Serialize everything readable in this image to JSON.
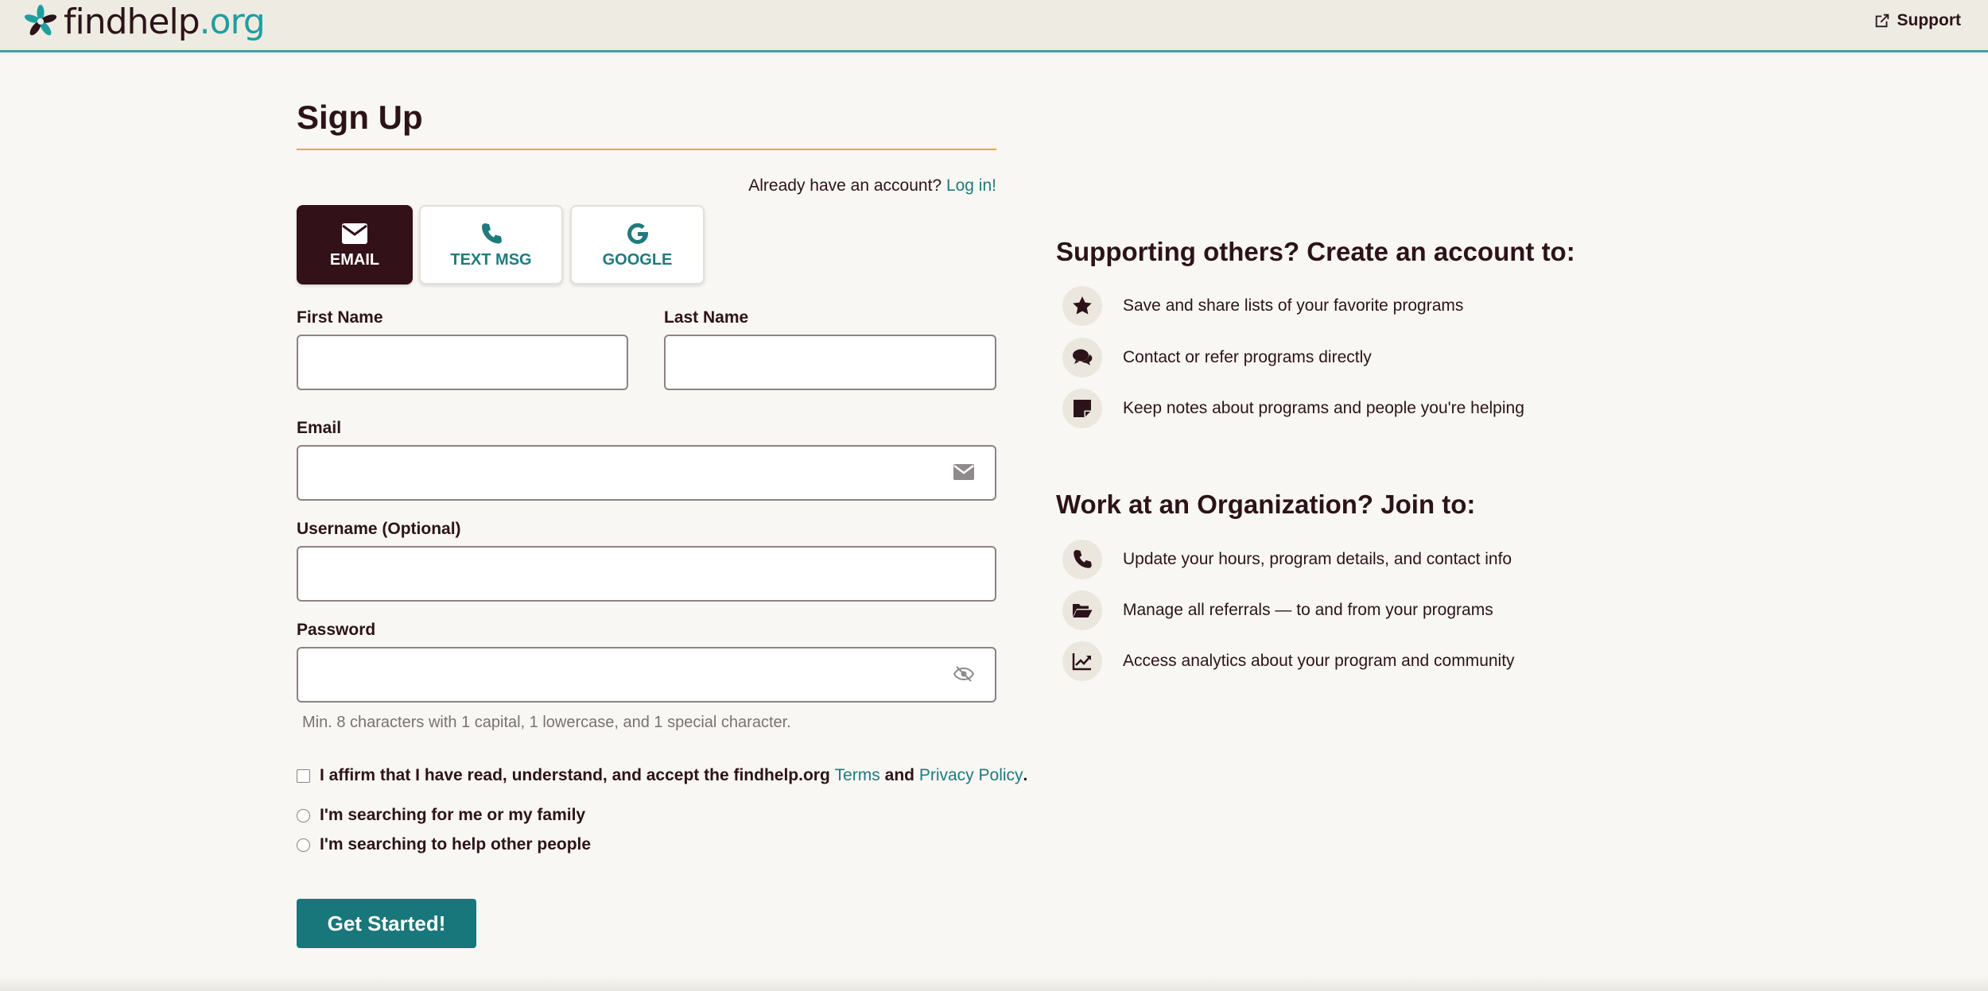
{
  "header": {
    "logo_find": "findhelp",
    "logo_suffix": ".org",
    "support_label": "Support"
  },
  "form": {
    "title": "Sign Up",
    "login_prompt": "Already have an account?",
    "login_link": "Log in!",
    "methods": [
      {
        "label": "EMAIL",
        "icon": "envelope-icon",
        "active": true
      },
      {
        "label": "TEXT MSG",
        "icon": "phone-icon",
        "active": false
      },
      {
        "label": "GOOGLE",
        "icon": "google-icon",
        "active": false
      }
    ],
    "first_name_label": "First Name",
    "first_name_value": "",
    "last_name_label": "Last Name",
    "last_name_value": "",
    "email_label": "Email",
    "email_value": "",
    "username_label": "Username (Optional)",
    "username_value": "",
    "password_label": "Password",
    "password_value": "",
    "password_hint": "Min. 8 characters with 1 capital, 1 lowercase, and 1 special character.",
    "affirm_text": "I affirm that I have read, understand, and accept the findhelp.org",
    "terms_link": "Terms",
    "and_text": "and",
    "privacy_link": "Privacy Policy",
    "period": ".",
    "radio_self": "I'm searching for me or my family",
    "radio_others": "I'm searching to help other people",
    "submit_label": "Get Started!"
  },
  "side": {
    "supporting_heading": "Supporting others? Create an account to:",
    "supporting_items": [
      {
        "icon": "star-icon",
        "text": "Save and share lists of your favorite programs"
      },
      {
        "icon": "chat-bubbles-icon",
        "text": "Contact or refer programs directly"
      },
      {
        "icon": "sticky-note-icon",
        "text": "Keep notes about programs and people you're helping"
      }
    ],
    "org_heading": "Work at an Organization? Join to:",
    "org_items": [
      {
        "icon": "phone-icon",
        "text": "Update your hours, program details, and contact info"
      },
      {
        "icon": "folder-open-icon",
        "text": "Manage all referrals — to and from your programs"
      },
      {
        "icon": "line-chart-icon",
        "text": "Access analytics about your program and community"
      }
    ]
  },
  "colors": {
    "brand_dark": "#321119",
    "brand_teal": "#17777a",
    "accent_gold": "#e1a93a",
    "header_border": "#3aa3a6"
  }
}
